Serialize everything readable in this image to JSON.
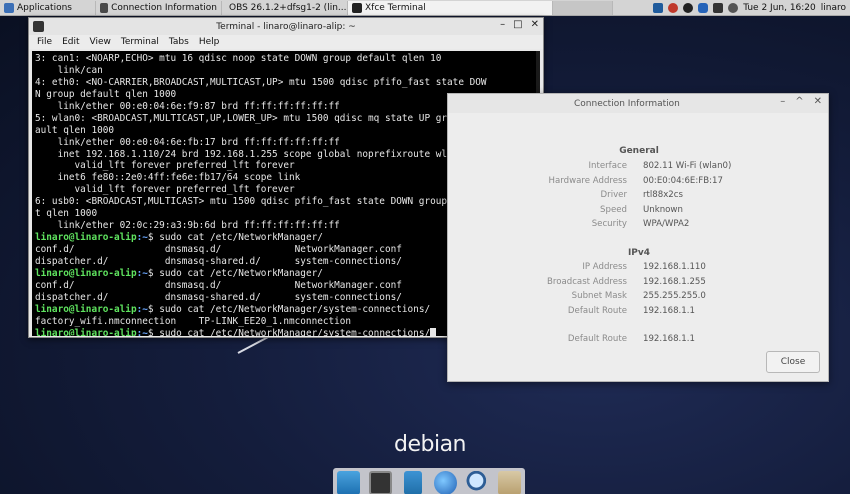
{
  "panel": {
    "applications_label": "Applications",
    "tasks": [
      {
        "label": "Connection Information"
      },
      {
        "label": "OBS 26.1.2+dfsg1-2 (lin..."
      },
      {
        "label": "Xfce Terminal"
      }
    ],
    "clock": "Tue  2 Jun, 16:20",
    "user": "linaro"
  },
  "terminal": {
    "title": "Terminal - linaro@linaro-alip: ~",
    "menu": [
      "File",
      "Edit",
      "View",
      "Terminal",
      "Tabs",
      "Help"
    ],
    "lines": [
      {
        "text": "3: can1: <NOARP,ECHO> mtu 16 qdisc noop state DOWN group default qlen 10"
      },
      {
        "text": "    link/can"
      },
      {
        "text": "4: eth0: <NO-CARRIER,BROADCAST,MULTICAST,UP> mtu 1500 qdisc pfifo_fast state DOW"
      },
      {
        "text": "N group default qlen 1000"
      },
      {
        "text": "    link/ether 00:e0:04:6e:f9:87 brd ff:ff:ff:ff:ff:ff"
      },
      {
        "text": "5: wlan0: <BROADCAST,MULTICAST,UP,LOWER_UP> mtu 1500 qdisc mq state UP group def"
      },
      {
        "text": "ault qlen 1000"
      },
      {
        "text": "    link/ether 00:e0:04:6e:fb:17 brd ff:ff:ff:ff:ff:ff"
      },
      {
        "text": "    inet 192.168.1.110/24 brd 192.168.1.255 scope global noprefixroute wlan0"
      },
      {
        "text": "       valid_lft forever preferred_lft forever"
      },
      {
        "text": "    inet6 fe80::2e0:4ff:fe6e:fb17/64 scope link"
      },
      {
        "text": "       valid_lft forever preferred_lft forever"
      },
      {
        "text": "6: usb0: <BROADCAST,MULTICAST> mtu 1500 qdisc pfifo_fast state DOWN group defaul"
      },
      {
        "text": "t qlen 1000"
      },
      {
        "text": "    link/ether 02:0c:29:a3:9b:6d brd ff:ff:ff:ff:ff:ff"
      },
      {
        "user": "linaro@linaro-alip",
        "path": ":~",
        "cmd": "$ sudo cat /etc/NetworkManager/"
      },
      {
        "text": "conf.d/                dnsmasq.d/             NetworkManager.conf"
      },
      {
        "text": "dispatcher.d/          dnsmasq-shared.d/      system-connections/"
      },
      {
        "user": "linaro@linaro-alip",
        "path": ":~",
        "cmd": "$ sudo cat /etc/NetworkManager/"
      },
      {
        "text": "conf.d/                dnsmasq.d/             NetworkManager.conf"
      },
      {
        "text": "dispatcher.d/          dnsmasq-shared.d/      system-connections/"
      },
      {
        "user": "linaro@linaro-alip",
        "path": ":~",
        "cmd": "$ sudo cat /etc/NetworkManager/system-connections/"
      },
      {
        "text": "factory_wifi.nmconnection    TP-LINK_EE20_1.nmconnection"
      },
      {
        "user": "linaro@linaro-alip",
        "path": ":~",
        "cmd": "$ sudo cat /etc/NetworkManager/system-connections/",
        "cursor": true
      }
    ]
  },
  "connection": {
    "title": "Connection Information",
    "general_heading": "General",
    "general": [
      {
        "label": "Interface",
        "value": "802.11 Wi-Fi (wlan0)"
      },
      {
        "label": "Hardware Address",
        "value": "00:E0:04:6E:FB:17"
      },
      {
        "label": "Driver",
        "value": "rtl88x2cs"
      },
      {
        "label": "Speed",
        "value": "Unknown"
      },
      {
        "label": "Security",
        "value": "WPA/WPA2"
      }
    ],
    "ipv4_heading": "IPv4",
    "ipv4": [
      {
        "label": "IP Address",
        "value": "192.168.1.110"
      },
      {
        "label": "Broadcast Address",
        "value": "192.168.1.255"
      },
      {
        "label": "Subnet Mask",
        "value": "255.255.255.0"
      },
      {
        "label": "Default Route",
        "value": "192.168.1.1"
      },
      {
        "label": "Default Route",
        "value": "192.168.1.1"
      }
    ],
    "close_label": "Close"
  },
  "desktop": {
    "logo_text": "debian"
  },
  "dock": [
    {
      "icon": "desktop-icon"
    },
    {
      "icon": "terminal-icon"
    },
    {
      "icon": "files-icon"
    },
    {
      "icon": "globe-icon"
    },
    {
      "icon": "search-icon"
    },
    {
      "icon": "folder-icon"
    }
  ]
}
